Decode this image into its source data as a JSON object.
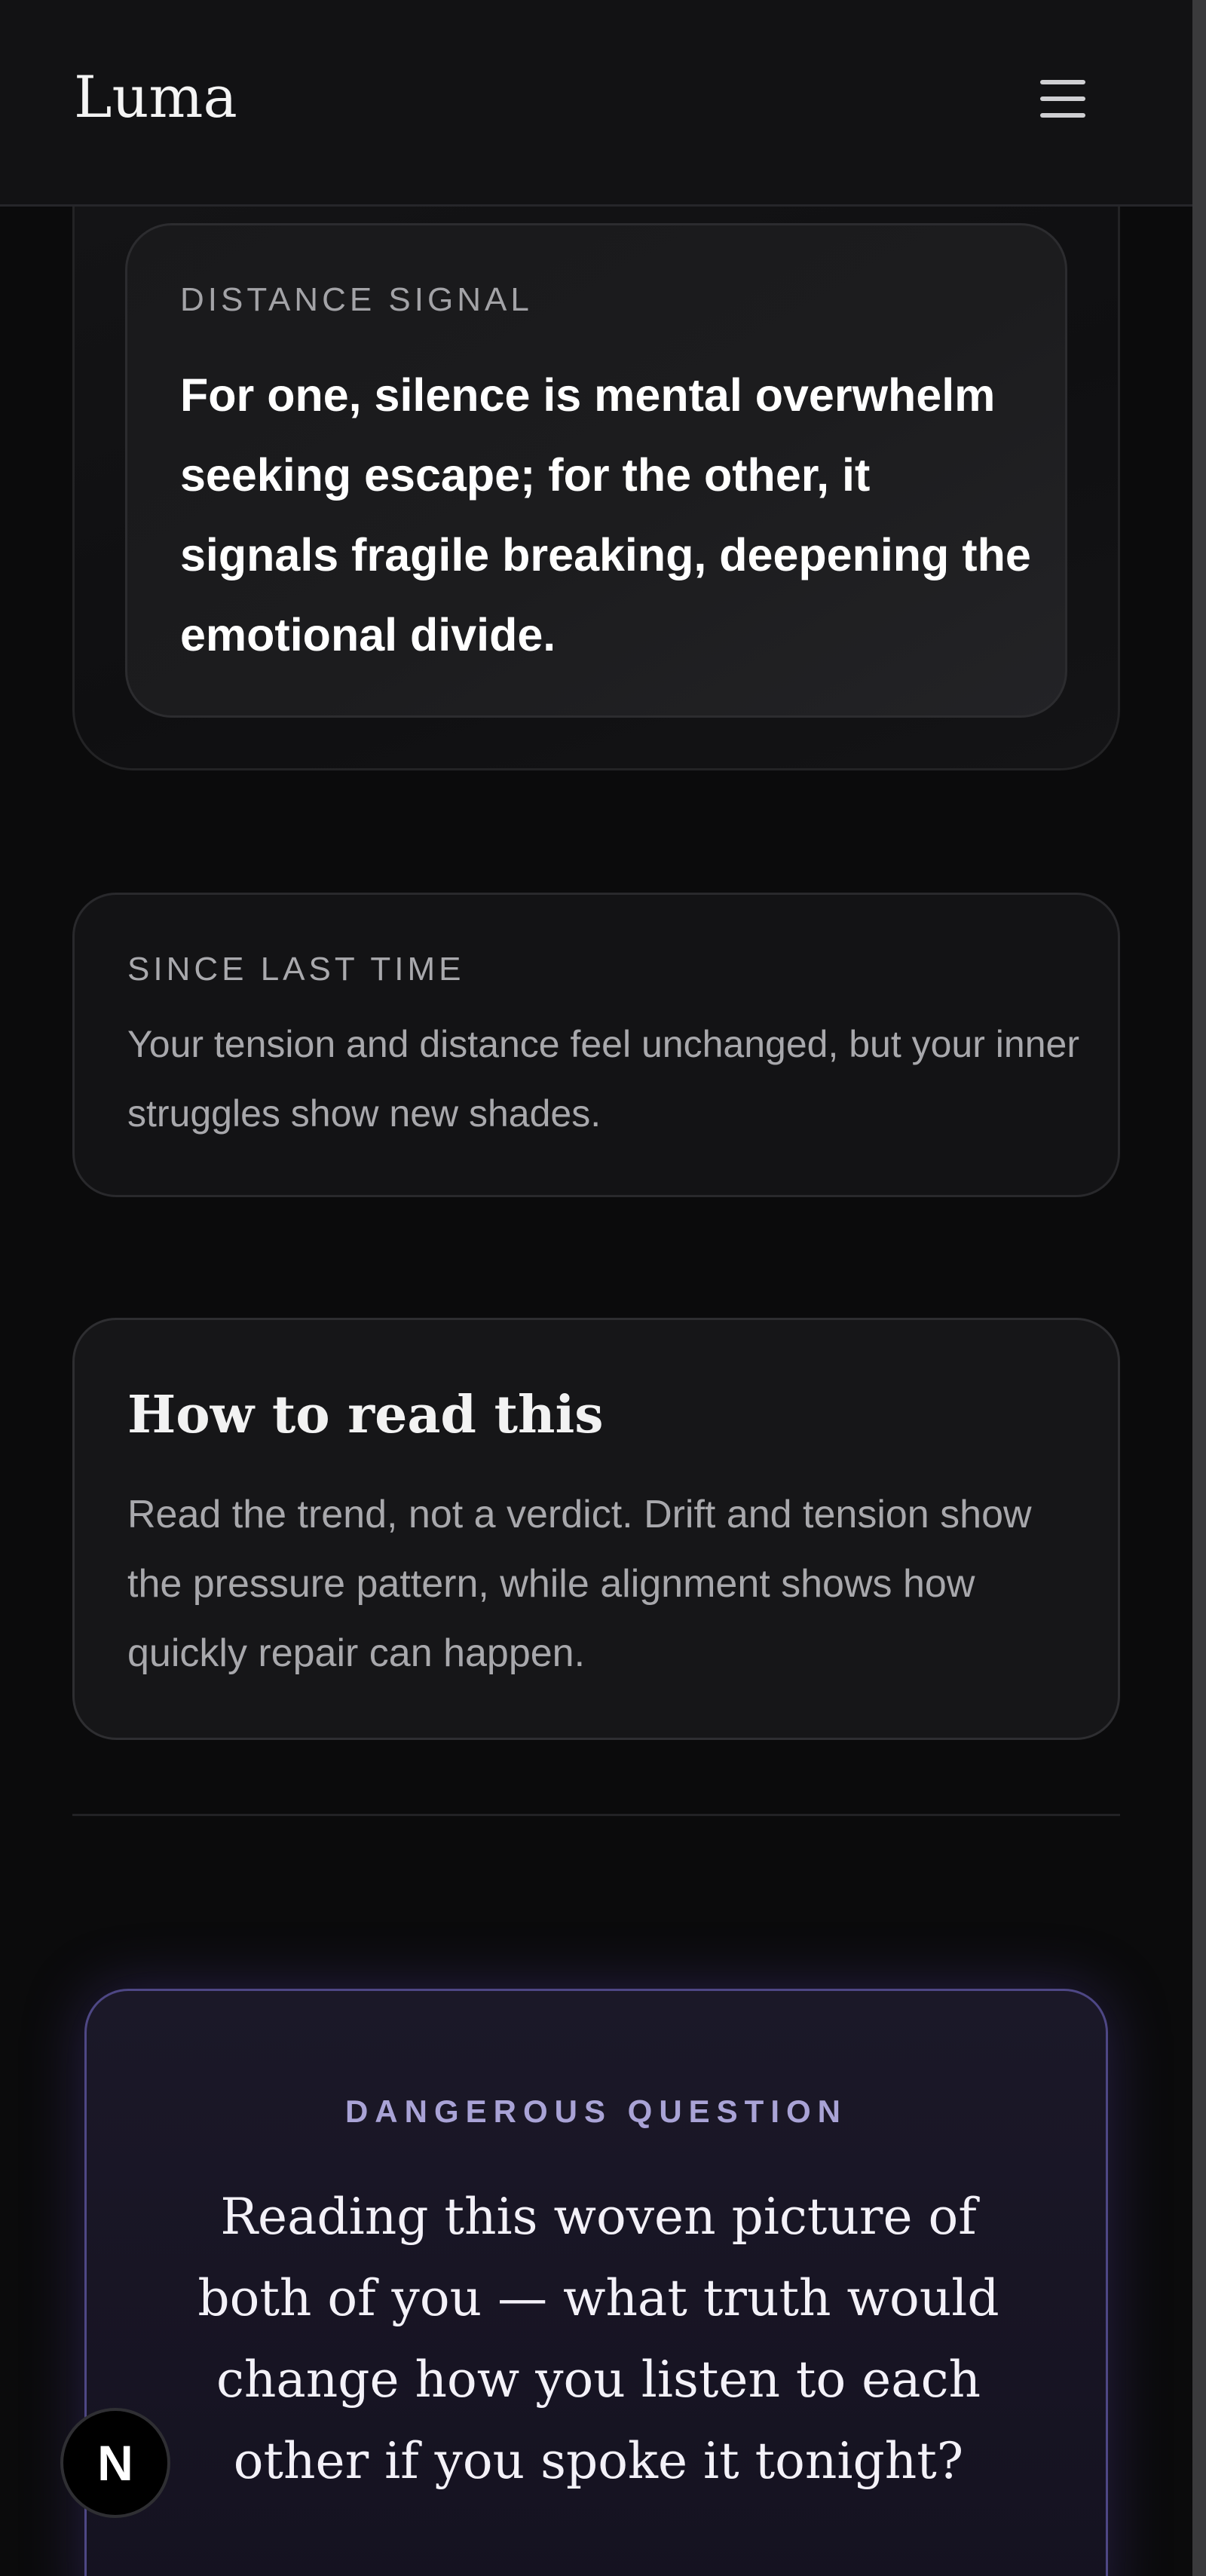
{
  "header": {
    "brand": "Luma",
    "menu_icon": "hamburger-menu-icon"
  },
  "distance_signal": {
    "label": "DISTANCE SIGNAL",
    "text": "For one, silence is mental overwhelm seeking escape; for the other, it signals fragile breaking, deepening the emotional divide."
  },
  "since_last_time": {
    "label": "SINCE LAST TIME",
    "text": "Your tension and distance feel unchanged, but your inner struggles show new shades."
  },
  "how_to_read": {
    "title": "How to read this",
    "text": "Read the trend, not a verdict. Drift and tension show the pressure pattern, while alignment shows how quickly repair can happen."
  },
  "dangerous_question": {
    "label": "DANGEROUS QUESTION",
    "text": "Reading this woven picture of both of you — what truth would change how you listen to each other if you spoke it tonight?"
  },
  "badge": {
    "letter": "N"
  },
  "colors": {
    "background": "#0b0b0c",
    "card": "#161618",
    "accent_purple": "#4e4785",
    "label_purple": "#a9a3d6"
  }
}
